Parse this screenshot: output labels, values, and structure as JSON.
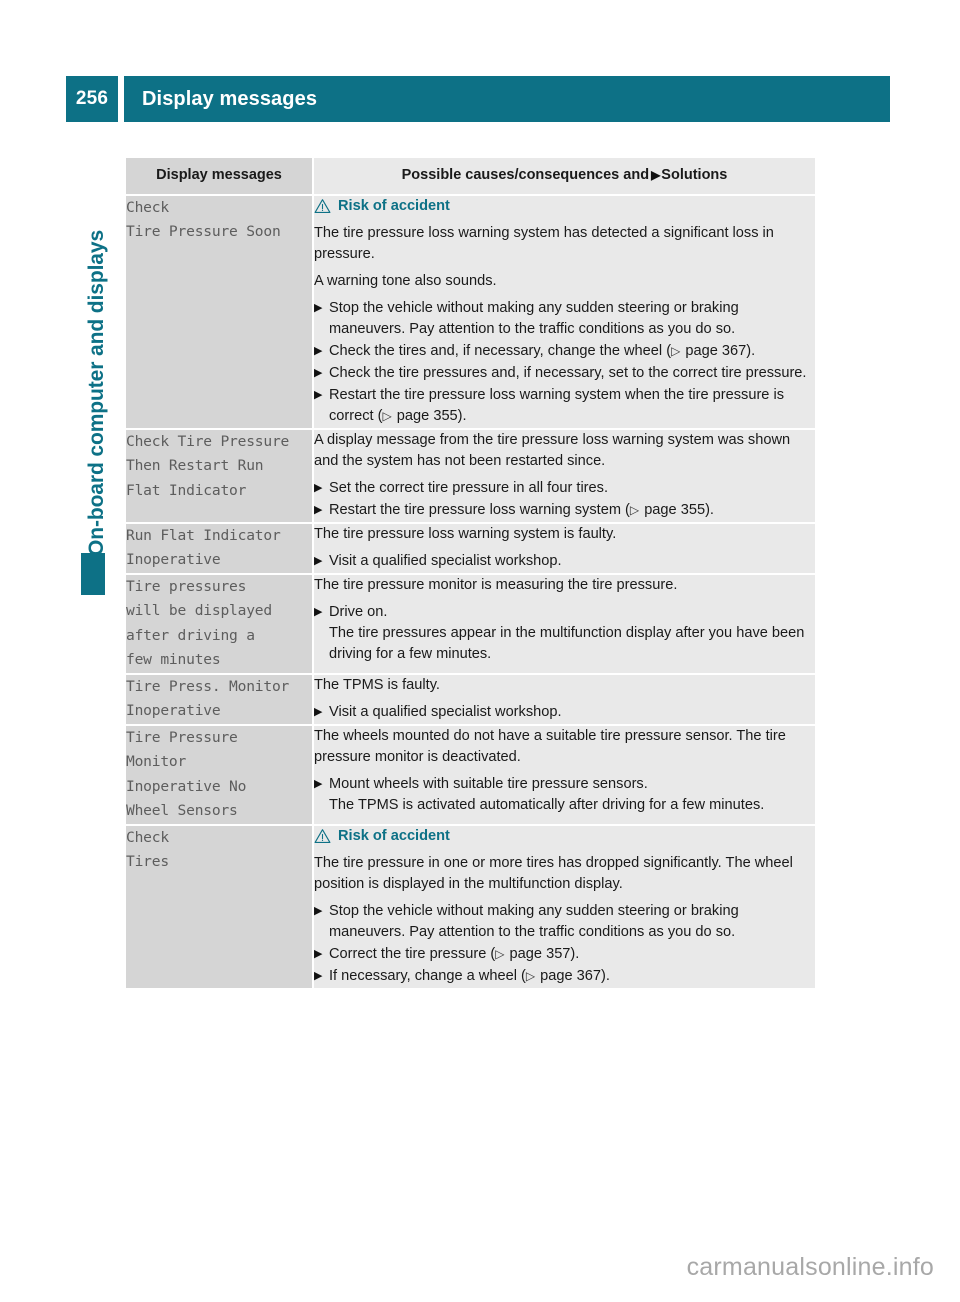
{
  "header": {
    "page_number": "256",
    "title": "Display messages"
  },
  "chapter": {
    "label": "On-board computer and displays"
  },
  "table": {
    "headers": {
      "left": "Display messages",
      "right_before": "Possible causes/consequences and",
      "right_arrow": "▶",
      "right_after": "Solutions"
    },
    "rows": [
      {
        "message": "Check\nTire Pressure Soon",
        "warning": {
          "icon": "warning-triangle-icon",
          "title": "Risk of accident"
        },
        "paragraphs": [
          "The tire pressure loss warning system has detected a significant loss in pressure.",
          "A warning tone also sounds."
        ],
        "steps": [
          {
            "text": "Stop the vehicle without making any sudden steering or braking maneuvers. Pay attention to the traffic conditions as you do so."
          },
          {
            "text": "Check the tires and, if necessary, change the wheel (▷ page 367)."
          },
          {
            "text": "Check the tire pressures and, if necessary, set to the correct tire pressure."
          },
          {
            "text": "Restart the tire pressure loss warning system when the tire pressure is correct (▷ page 355)."
          }
        ]
      },
      {
        "message": "Check Tire Pressure\nThen Restart Run\nFlat Indicator",
        "warning": null,
        "paragraphs": [
          "A display message from the tire pressure loss warning system was shown and the system has not been restarted since."
        ],
        "steps": [
          {
            "text": "Set the correct tire pressure in all four tires."
          },
          {
            "text": "Restart the tire pressure loss warning system (▷ page 355)."
          }
        ]
      },
      {
        "message": "Run Flat Indicator\nInoperative",
        "warning": null,
        "paragraphs": [
          "The tire pressure loss warning system is faulty."
        ],
        "steps": [
          {
            "text": "Visit a qualified specialist workshop."
          }
        ]
      },
      {
        "message": "Tire pressures\nwill be displayed\nafter driving a\nfew minutes",
        "warning": null,
        "paragraphs": [
          "The tire pressure monitor is measuring the tire pressure."
        ],
        "steps": [
          {
            "text": "Drive on.",
            "sub": "The tire pressures appear in the multifunction display after you have been driving for a few minutes."
          }
        ]
      },
      {
        "message": "Tire Press. Monitor\nInoperative",
        "warning": null,
        "paragraphs": [
          "The TPMS is faulty."
        ],
        "steps": [
          {
            "text": "Visit a qualified specialist workshop."
          }
        ]
      },
      {
        "message": "Tire Pressure\nMonitor\nInoperative No\nWheel Sensors",
        "warning": null,
        "paragraphs": [
          "The wheels mounted do not have a suitable tire pressure sensor. The tire pressure monitor is deactivated."
        ],
        "steps": [
          {
            "text": "Mount wheels with suitable tire pressure sensors.",
            "sub": "The TPMS is activated automatically after driving for a few minutes."
          }
        ]
      },
      {
        "message": "Check\nTires",
        "warning": {
          "icon": "warning-triangle-icon",
          "title": "Risk of accident"
        },
        "paragraphs": [
          "The tire pressure in one or more tires has dropped significantly. The wheel position is displayed in the multifunction display."
        ],
        "steps": [
          {
            "text": "Stop the vehicle without making any sudden steering or braking maneuvers. Pay attention to the traffic conditions as you do so."
          },
          {
            "text": "Correct the tire pressure (▷ page 357)."
          },
          {
            "text": "If necessary, change a wheel (▷ page 367)."
          }
        ]
      }
    ]
  },
  "watermark": "carmanualsonline.info",
  "colors": {
    "brand_teal": "#0d7186",
    "left_cell_bg": "#d5d5d5",
    "right_cell_bg": "#e9e9e9"
  }
}
